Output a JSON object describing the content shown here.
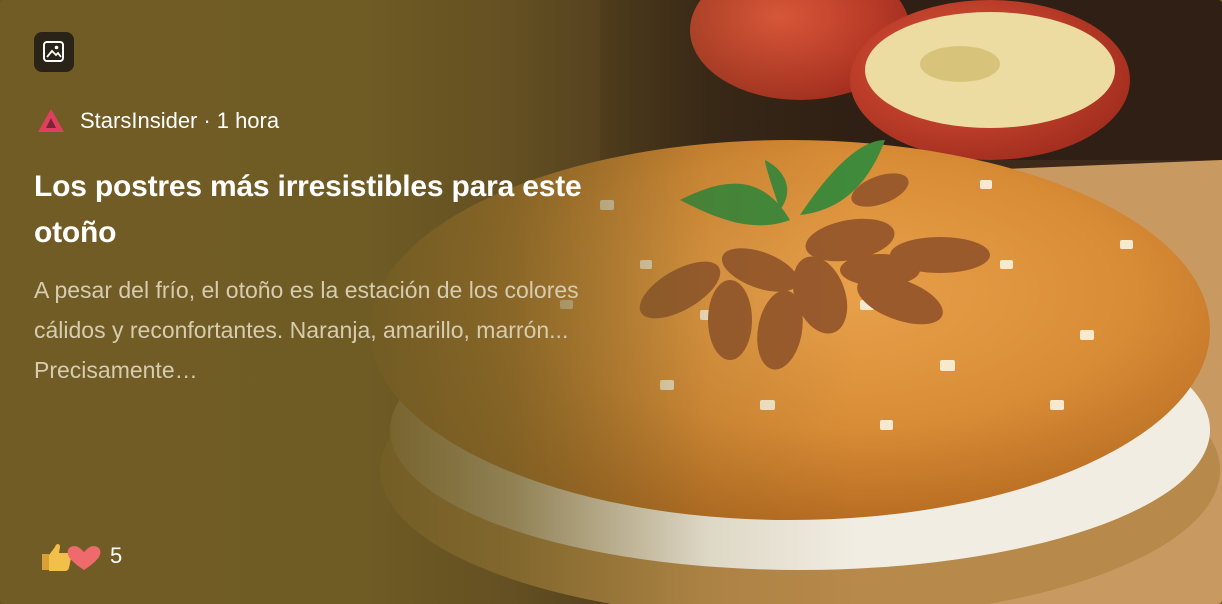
{
  "source": {
    "name": "StarsInsider",
    "separator": "·",
    "time": "1 hora"
  },
  "article": {
    "title": "Los postres más irresistibles para este otoño",
    "description": "A pesar del frío, el otoño es la estación de los colores cálidos y reconfortantes. Naranja, amarillo, marrón... Precisamente…"
  },
  "reactions": {
    "count": "5",
    "icons": [
      "thumbs-up-icon",
      "heart-icon"
    ]
  },
  "colors": {
    "card_bg": "#705c24",
    "logo": "#e0405e",
    "description": "#d6ccb1"
  }
}
